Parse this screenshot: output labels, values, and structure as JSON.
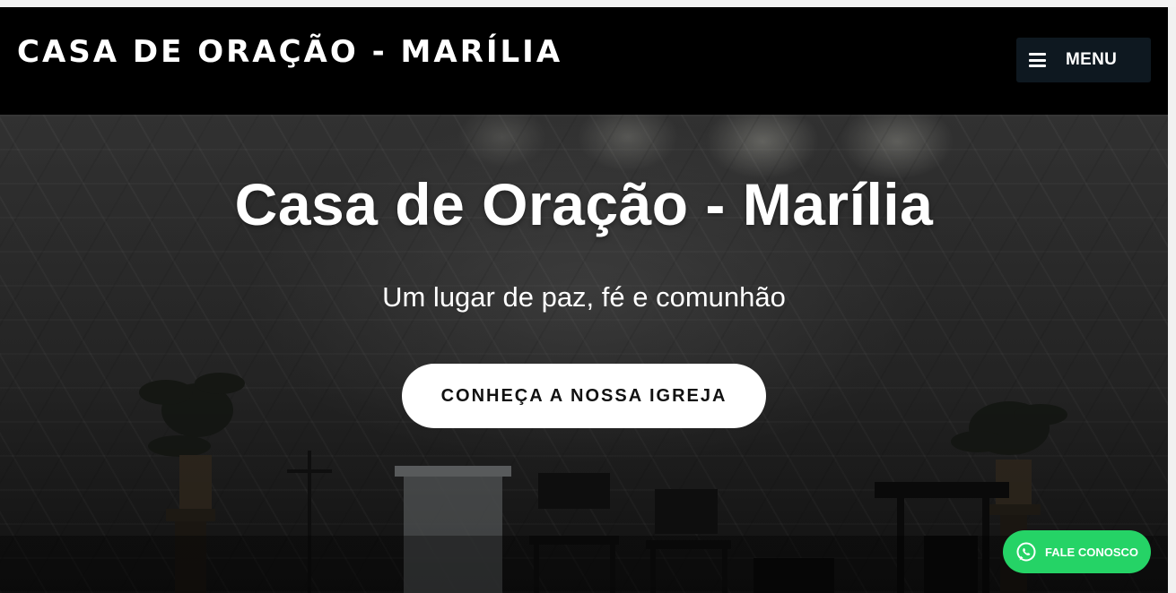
{
  "header": {
    "brand": "CASA DE ORAÇÃO - MARÍLIA",
    "menu_label": "MENU"
  },
  "hero": {
    "title": "Casa de Oração - Marília",
    "subtitle": "Um lugar de paz, fé e comunhão",
    "cta_label": "CONHEÇA A NOSSA IGREJA"
  },
  "whatsapp": {
    "label": "FALE CONOSCO",
    "color": "#25d366"
  },
  "icons": {
    "menu": "hamburger-icon",
    "whatsapp": "whatsapp-icon"
  }
}
